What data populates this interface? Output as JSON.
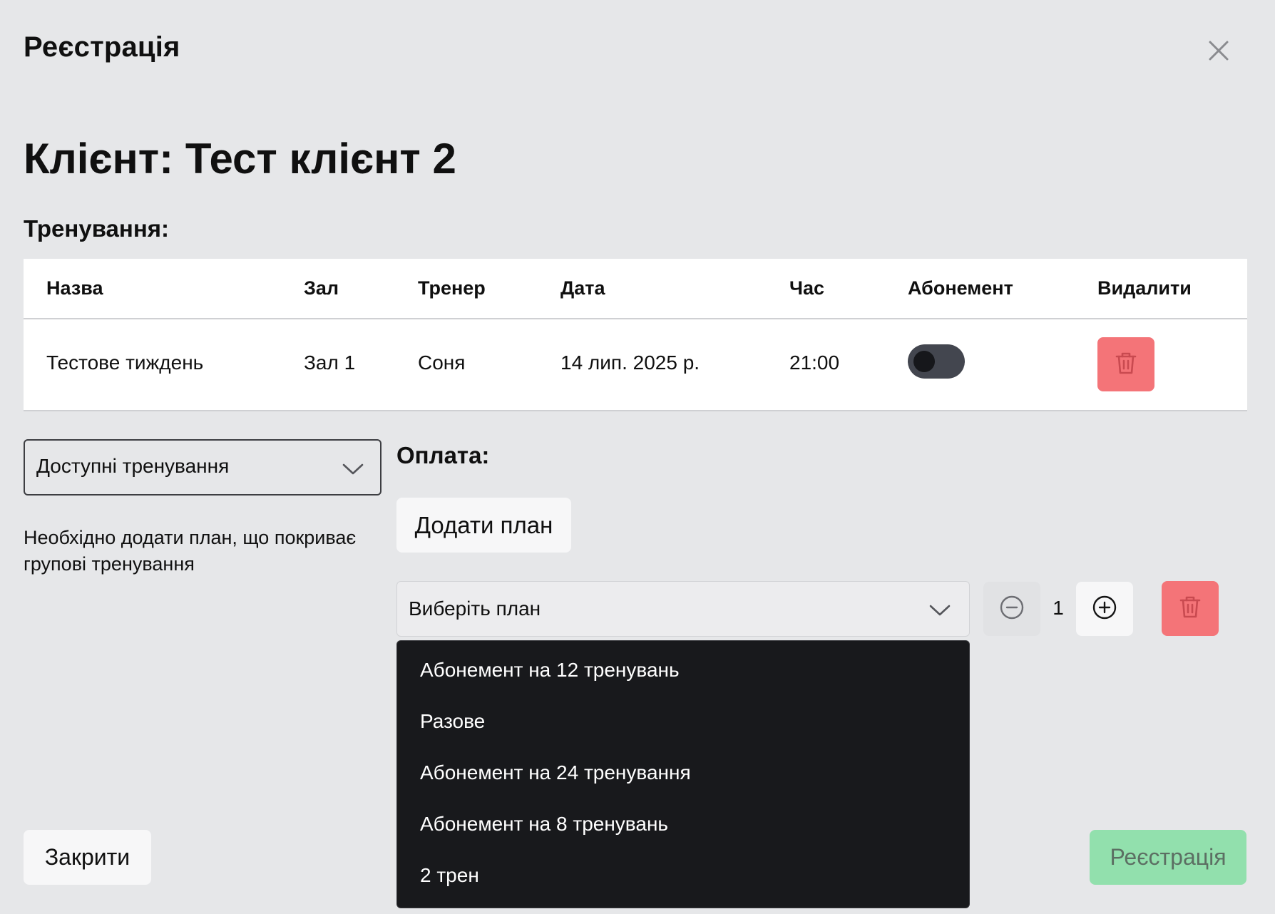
{
  "modal": {
    "title": "Реєстрація",
    "close_icon": "close-icon"
  },
  "client": {
    "title": "Клієнт: Тест клієнт 2"
  },
  "trainings": {
    "label": "Тренування:",
    "columns": [
      "Назва",
      "Зал",
      "Тренер",
      "Дата",
      "Час",
      "Абонемент",
      "Видалити"
    ],
    "rows": [
      {
        "name": "Тестове тиждень",
        "hall": "Зал 1",
        "trainer": "Соня",
        "date": "14 лип. 2025 р.",
        "time": "21:00",
        "subscription_toggle": false
      }
    ]
  },
  "available": {
    "placeholder": "Доступні тренування",
    "help": "Необхідно додати план, що покриває групові тренування"
  },
  "payment": {
    "label": "Оплата:",
    "add_plan": "Додати план",
    "plan_placeholder": "Виберіть план",
    "quantity": "1",
    "options": [
      "Абонемент на 12 тренувань",
      "Разове",
      "Абонемент на 24 тренування",
      "Абонемент на 8 тренувань",
      "2 трен"
    ]
  },
  "footer": {
    "close": "Закрити",
    "register": "Реєстрація"
  },
  "colors": {
    "danger": "#f47478",
    "success": "#92e0ad",
    "dropdown_bg": "#18191c",
    "background": "#e6e7e9"
  }
}
